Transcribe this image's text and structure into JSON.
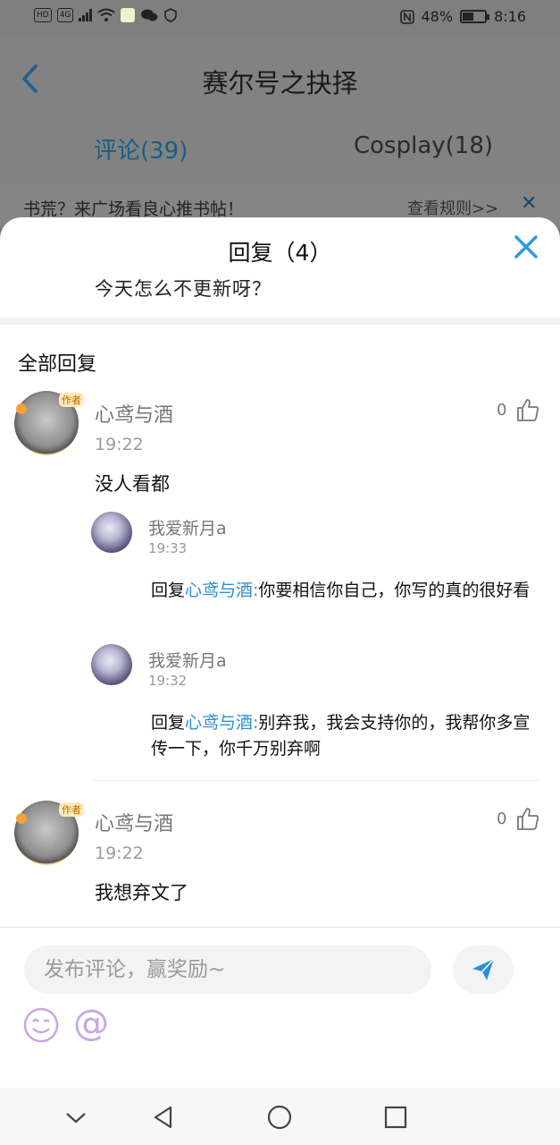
{
  "status_bar": {
    "left_chips": [
      "HD",
      "4G"
    ],
    "battery_text": "48%",
    "battery_level": 0.48,
    "time": "8:16"
  },
  "header": {
    "title": "赛尔号之抉择",
    "tabs": [
      {
        "label": "评论(39)",
        "active": true
      },
      {
        "label": "Cosplay(18)",
        "active": false
      }
    ]
  },
  "banner": {
    "text": "书荒？来广场看良心推书帖！",
    "rules_link": "查看规则>>"
  },
  "sheet": {
    "title": "回复（4）",
    "subtitle": "今天怎么不更新呀？",
    "section_label": "全部回复",
    "threads": [
      {
        "author": "心鸢与酒",
        "author_tag": "作者",
        "time": "19:22",
        "content": "没人看都",
        "likes": "0",
        "replies": [
          {
            "user": "我爱新月a",
            "time": "19:33",
            "prefix": "回复",
            "mention": "心鸢与酒:",
            "text": "你要相信你自己，你写的真的很好看"
          },
          {
            "user": "我爱新月a",
            "time": "19:32",
            "prefix": "回复",
            "mention": "心鸢与酒:",
            "text": "别弃我，我会支持你的，我帮你多宣传一下，你千万别弃啊"
          }
        ]
      },
      {
        "author": "心鸢与酒",
        "author_tag": "作者",
        "time": "19:22",
        "content": "我想弃文了",
        "likes": "0"
      }
    ]
  },
  "composer": {
    "placeholder": "发布评论，赢奖励~",
    "at_symbol": "@"
  },
  "colors": {
    "accent": "#2a8fd0",
    "close": "#2b9be0"
  },
  "icons": [
    "back-arrow-icon",
    "close-icon",
    "like-icon",
    "send-icon",
    "emoji-icon",
    "at-icon",
    "nav-down-icon",
    "nav-back-icon",
    "nav-home-icon",
    "nav-recents-icon"
  ]
}
